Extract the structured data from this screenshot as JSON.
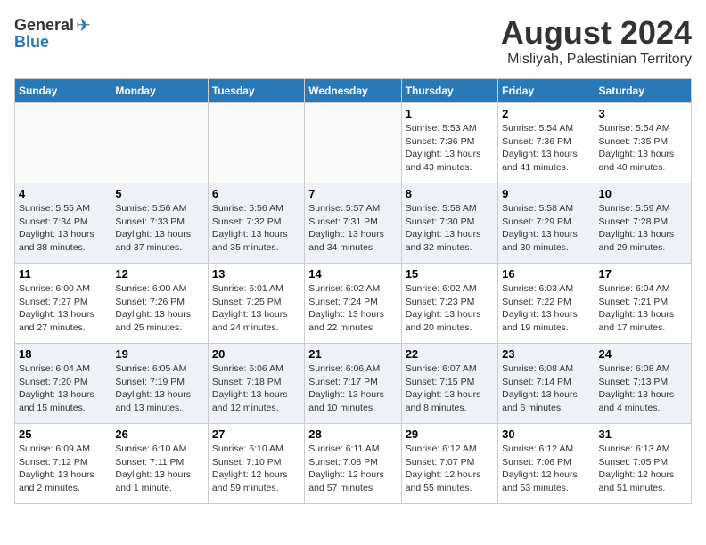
{
  "logo": {
    "general": "General",
    "blue": "Blue"
  },
  "title": {
    "month_year": "August 2024",
    "location": "Misliyah, Palestinian Territory"
  },
  "weekdays": [
    "Sunday",
    "Monday",
    "Tuesday",
    "Wednesday",
    "Thursday",
    "Friday",
    "Saturday"
  ],
  "weeks": [
    [
      {
        "day": "",
        "info": ""
      },
      {
        "day": "",
        "info": ""
      },
      {
        "day": "",
        "info": ""
      },
      {
        "day": "",
        "info": ""
      },
      {
        "day": "1",
        "info": "Sunrise: 5:53 AM\nSunset: 7:36 PM\nDaylight: 13 hours and 43 minutes."
      },
      {
        "day": "2",
        "info": "Sunrise: 5:54 AM\nSunset: 7:36 PM\nDaylight: 13 hours and 41 minutes."
      },
      {
        "day": "3",
        "info": "Sunrise: 5:54 AM\nSunset: 7:35 PM\nDaylight: 13 hours and 40 minutes."
      }
    ],
    [
      {
        "day": "4",
        "info": "Sunrise: 5:55 AM\nSunset: 7:34 PM\nDaylight: 13 hours and 38 minutes."
      },
      {
        "day": "5",
        "info": "Sunrise: 5:56 AM\nSunset: 7:33 PM\nDaylight: 13 hours and 37 minutes."
      },
      {
        "day": "6",
        "info": "Sunrise: 5:56 AM\nSunset: 7:32 PM\nDaylight: 13 hours and 35 minutes."
      },
      {
        "day": "7",
        "info": "Sunrise: 5:57 AM\nSunset: 7:31 PM\nDaylight: 13 hours and 34 minutes."
      },
      {
        "day": "8",
        "info": "Sunrise: 5:58 AM\nSunset: 7:30 PM\nDaylight: 13 hours and 32 minutes."
      },
      {
        "day": "9",
        "info": "Sunrise: 5:58 AM\nSunset: 7:29 PM\nDaylight: 13 hours and 30 minutes."
      },
      {
        "day": "10",
        "info": "Sunrise: 5:59 AM\nSunset: 7:28 PM\nDaylight: 13 hours and 29 minutes."
      }
    ],
    [
      {
        "day": "11",
        "info": "Sunrise: 6:00 AM\nSunset: 7:27 PM\nDaylight: 13 hours and 27 minutes."
      },
      {
        "day": "12",
        "info": "Sunrise: 6:00 AM\nSunset: 7:26 PM\nDaylight: 13 hours and 25 minutes."
      },
      {
        "day": "13",
        "info": "Sunrise: 6:01 AM\nSunset: 7:25 PM\nDaylight: 13 hours and 24 minutes."
      },
      {
        "day": "14",
        "info": "Sunrise: 6:02 AM\nSunset: 7:24 PM\nDaylight: 13 hours and 22 minutes."
      },
      {
        "day": "15",
        "info": "Sunrise: 6:02 AM\nSunset: 7:23 PM\nDaylight: 13 hours and 20 minutes."
      },
      {
        "day": "16",
        "info": "Sunrise: 6:03 AM\nSunset: 7:22 PM\nDaylight: 13 hours and 19 minutes."
      },
      {
        "day": "17",
        "info": "Sunrise: 6:04 AM\nSunset: 7:21 PM\nDaylight: 13 hours and 17 minutes."
      }
    ],
    [
      {
        "day": "18",
        "info": "Sunrise: 6:04 AM\nSunset: 7:20 PM\nDaylight: 13 hours and 15 minutes."
      },
      {
        "day": "19",
        "info": "Sunrise: 6:05 AM\nSunset: 7:19 PM\nDaylight: 13 hours and 13 minutes."
      },
      {
        "day": "20",
        "info": "Sunrise: 6:06 AM\nSunset: 7:18 PM\nDaylight: 13 hours and 12 minutes."
      },
      {
        "day": "21",
        "info": "Sunrise: 6:06 AM\nSunset: 7:17 PM\nDaylight: 13 hours and 10 minutes."
      },
      {
        "day": "22",
        "info": "Sunrise: 6:07 AM\nSunset: 7:15 PM\nDaylight: 13 hours and 8 minutes."
      },
      {
        "day": "23",
        "info": "Sunrise: 6:08 AM\nSunset: 7:14 PM\nDaylight: 13 hours and 6 minutes."
      },
      {
        "day": "24",
        "info": "Sunrise: 6:08 AM\nSunset: 7:13 PM\nDaylight: 13 hours and 4 minutes."
      }
    ],
    [
      {
        "day": "25",
        "info": "Sunrise: 6:09 AM\nSunset: 7:12 PM\nDaylight: 13 hours and 2 minutes."
      },
      {
        "day": "26",
        "info": "Sunrise: 6:10 AM\nSunset: 7:11 PM\nDaylight: 13 hours and 1 minute."
      },
      {
        "day": "27",
        "info": "Sunrise: 6:10 AM\nSunset: 7:10 PM\nDaylight: 12 hours and 59 minutes."
      },
      {
        "day": "28",
        "info": "Sunrise: 6:11 AM\nSunset: 7:08 PM\nDaylight: 12 hours and 57 minutes."
      },
      {
        "day": "29",
        "info": "Sunrise: 6:12 AM\nSunset: 7:07 PM\nDaylight: 12 hours and 55 minutes."
      },
      {
        "day": "30",
        "info": "Sunrise: 6:12 AM\nSunset: 7:06 PM\nDaylight: 12 hours and 53 minutes."
      },
      {
        "day": "31",
        "info": "Sunrise: 6:13 AM\nSunset: 7:05 PM\nDaylight: 12 hours and 51 minutes."
      }
    ]
  ]
}
